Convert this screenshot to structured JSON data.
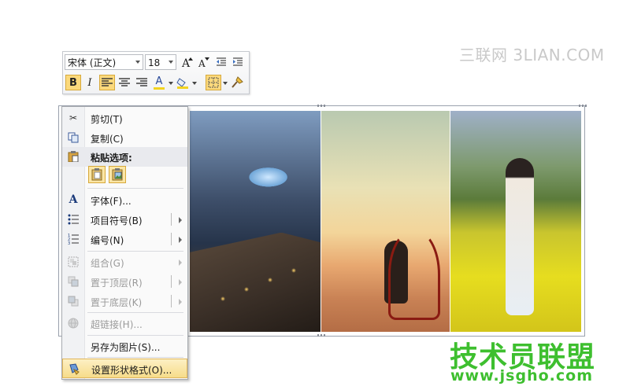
{
  "watermark_top": "三联网 3LIAN.COM",
  "mini_toolbar": {
    "font_name": "宋体 (正文)",
    "font_size": "18",
    "bold": "B",
    "italic": "I",
    "font_color_glyph": "A"
  },
  "context_menu": {
    "cut": "剪切(T)",
    "copy": "复制(C)",
    "paste_options_header": "粘贴选项:",
    "font": "字体(F)...",
    "bullets": "项目符号(B)",
    "numbering": "编号(N)",
    "group": "组合(G)",
    "bring_to_front": "置于顶层(R)",
    "send_to_back": "置于底层(K)",
    "hyperlink": "超链接(H)...",
    "save_as_picture": "另存为图片(S)...",
    "format_shape": "设置形状格式(O)..."
  },
  "watermark_bottom": {
    "logo": "技术员联盟",
    "url": "www.jsgho.com"
  },
  "colors": {
    "highlight": "#fbd97c",
    "watermark_green": "#3ebf2f"
  }
}
